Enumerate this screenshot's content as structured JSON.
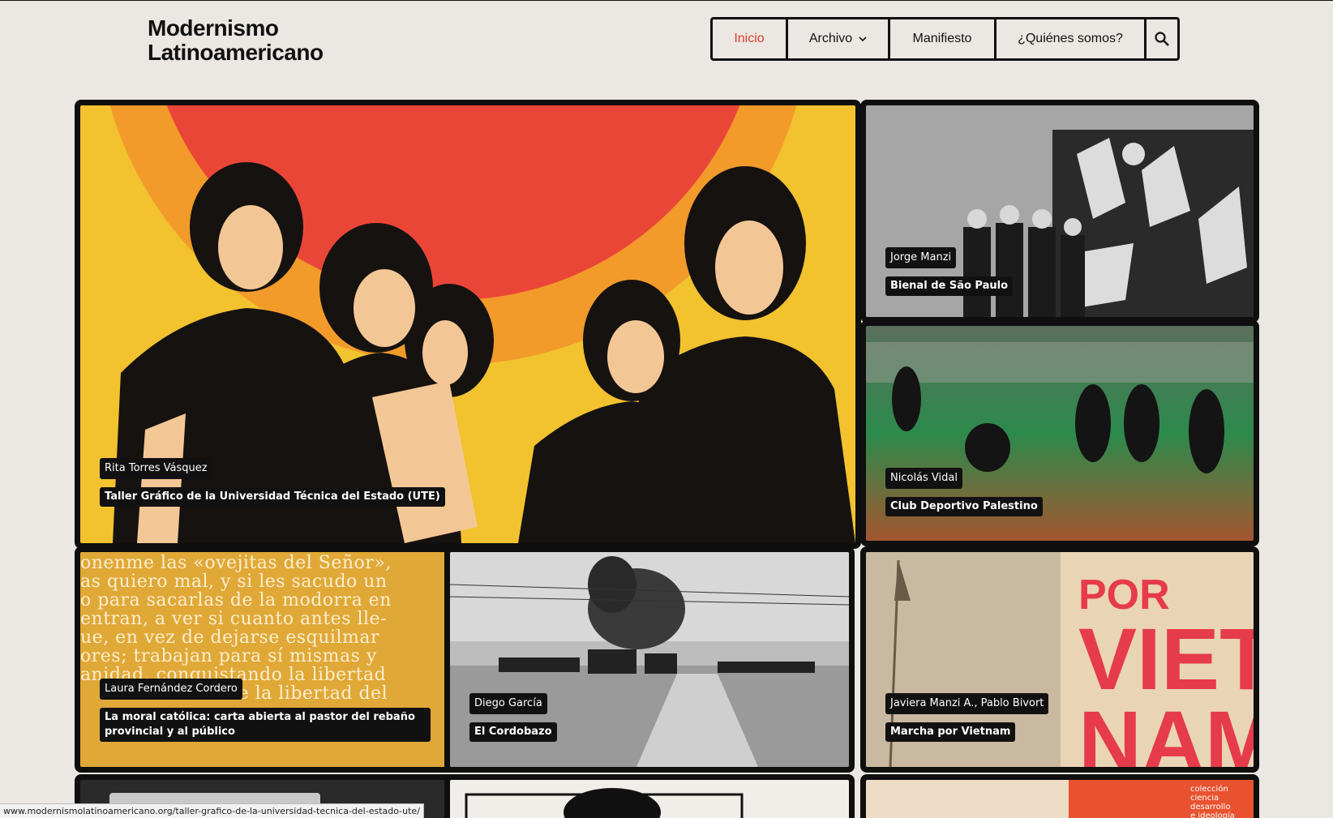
{
  "site": {
    "logo_line1": "Modernismo",
    "logo_line2": "Latinoamericano"
  },
  "nav": {
    "items": [
      {
        "label": "Inicio",
        "active": true
      },
      {
        "label": "Archivo",
        "has_dropdown": true
      },
      {
        "label": "Manifiesto"
      },
      {
        "label": "¿Quiénes somos?"
      }
    ],
    "search_icon": "search-icon",
    "active_color": "#e23a2b"
  },
  "cards": [
    {
      "author": "Rita Torres Vásquez",
      "title": "Taller Gráfico de la Universidad Técnica del Estado (UTE)"
    },
    {
      "author": "Jorge Manzi",
      "title": "Bienal de São Paulo"
    },
    {
      "author": "Nicolás Vidal",
      "title": "Club Deportivo Palestino"
    },
    {
      "author": "Laura Fernández Cordero",
      "title": "La moral católica: carta abierta al pastor del rebaño provincial y al público"
    },
    {
      "author": "Diego García",
      "title": "El Cordobazo"
    },
    {
      "author": "Javiera Manzi A., Pablo Bivort",
      "title": "Marcha por Vietnam"
    }
  ],
  "card_images": {
    "poster_text": [
      "POR",
      "VIET-",
      "NAM"
    ],
    "yellow_doc_text": [
      "onenme las «ovejitas del Señor»,",
      "as quiero mal, y si les sacudo un",
      "o para sacarlas de la modorra en",
      "entran, a ver si cuanto antes lle-",
      "ue, en vez de dejarse esquilmar",
      "ores; trabajan para sí mismas y",
      "anidad, conquistando la libertad",
      "de la libertad del"
    ],
    "bottom_right_text": [
      "colección",
      "ciencia",
      "desarrollo",
      "e ideología"
    ]
  },
  "status_bar": {
    "url": "www.modernismolatinoamericano.org/taller-grafico-de-la-universidad-tecnica-del-estado-ute/"
  }
}
